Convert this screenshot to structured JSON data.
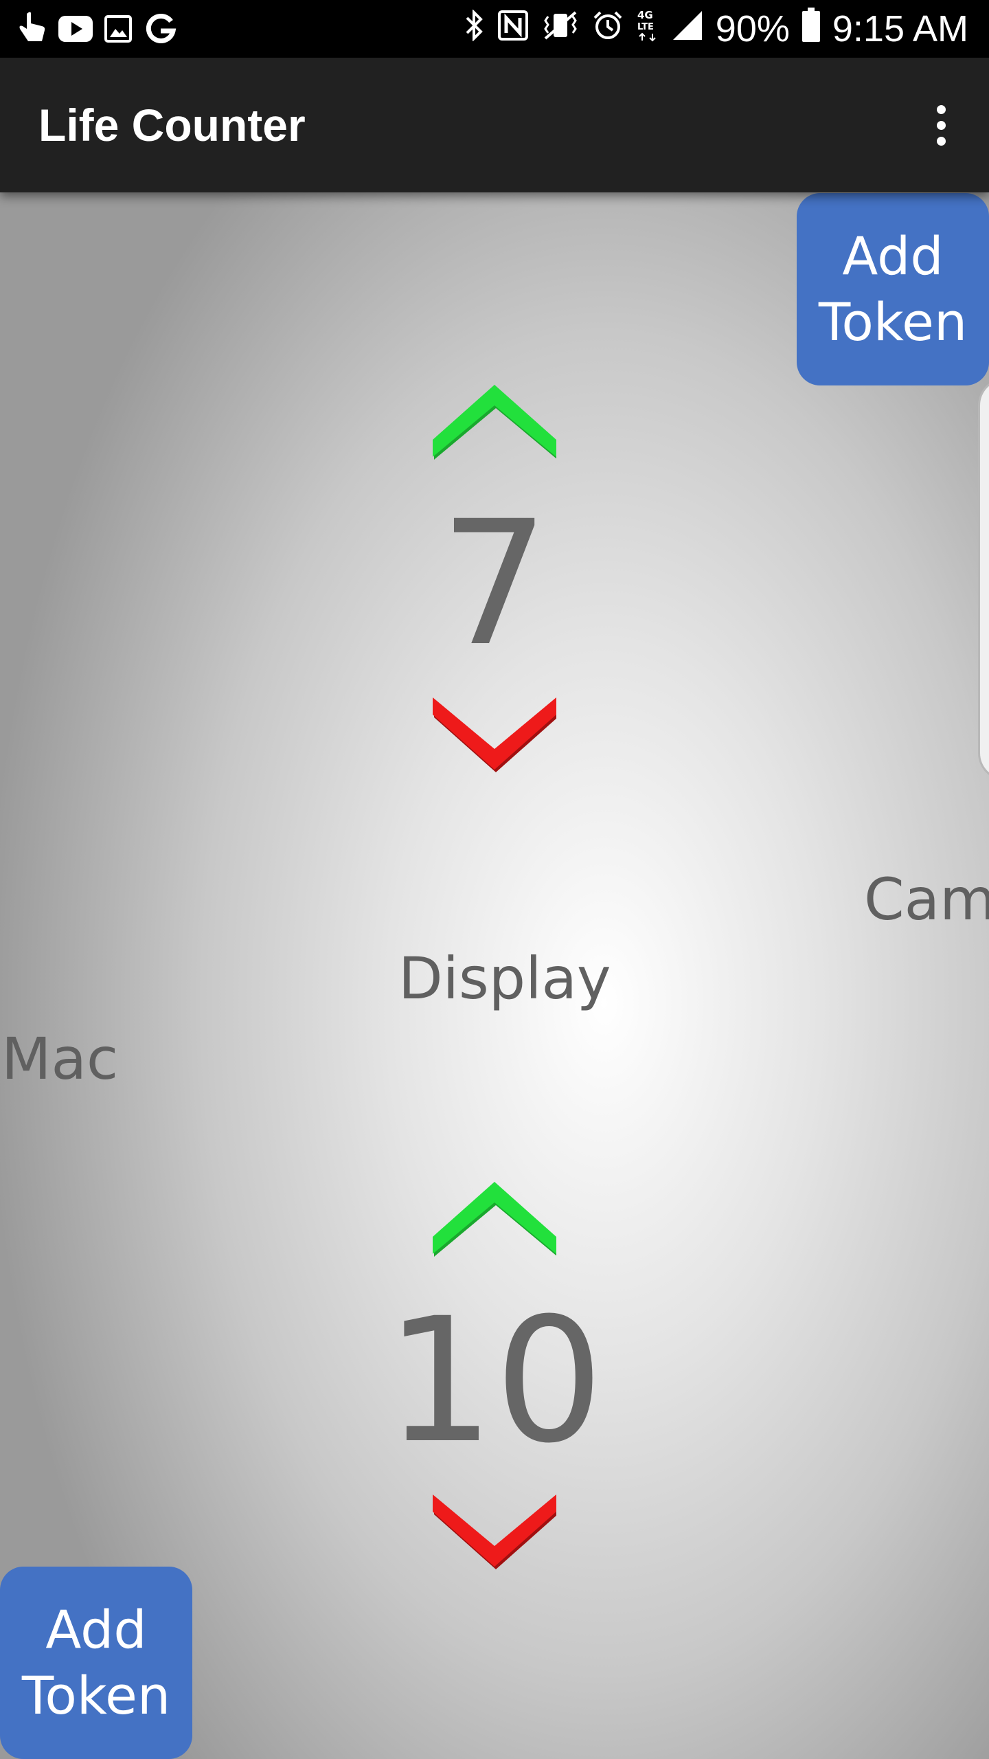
{
  "status_bar": {
    "battery": "90%",
    "time": "9:15 AM",
    "left_icons": [
      "touch-icon",
      "youtube-icon",
      "gallery-icon",
      "google-icon"
    ],
    "right_icons": [
      "bluetooth-icon",
      "nfc-icon",
      "vibrate-icon",
      "alarm-icon",
      "lte-icon",
      "signal-icon",
      "battery-icon"
    ]
  },
  "app_bar": {
    "title": "Life Counter",
    "menu_icon": "more-vert-icon"
  },
  "main": {
    "top_add_token": {
      "line1": "Add",
      "line2": "Token"
    },
    "bottom_add_token": {
      "line1": "Add",
      "line2": "Token"
    },
    "top_counter": {
      "value": "7"
    },
    "bottom_counter": {
      "value": "10"
    },
    "label_display": "Display",
    "label_left": "Mac",
    "label_right": "Cam"
  },
  "colors": {
    "increment_arrow": "#22e03c",
    "decrement_arrow": "#ee1a1a",
    "add_token_bg": "#4472c4",
    "app_bar_bg": "#212121"
  }
}
